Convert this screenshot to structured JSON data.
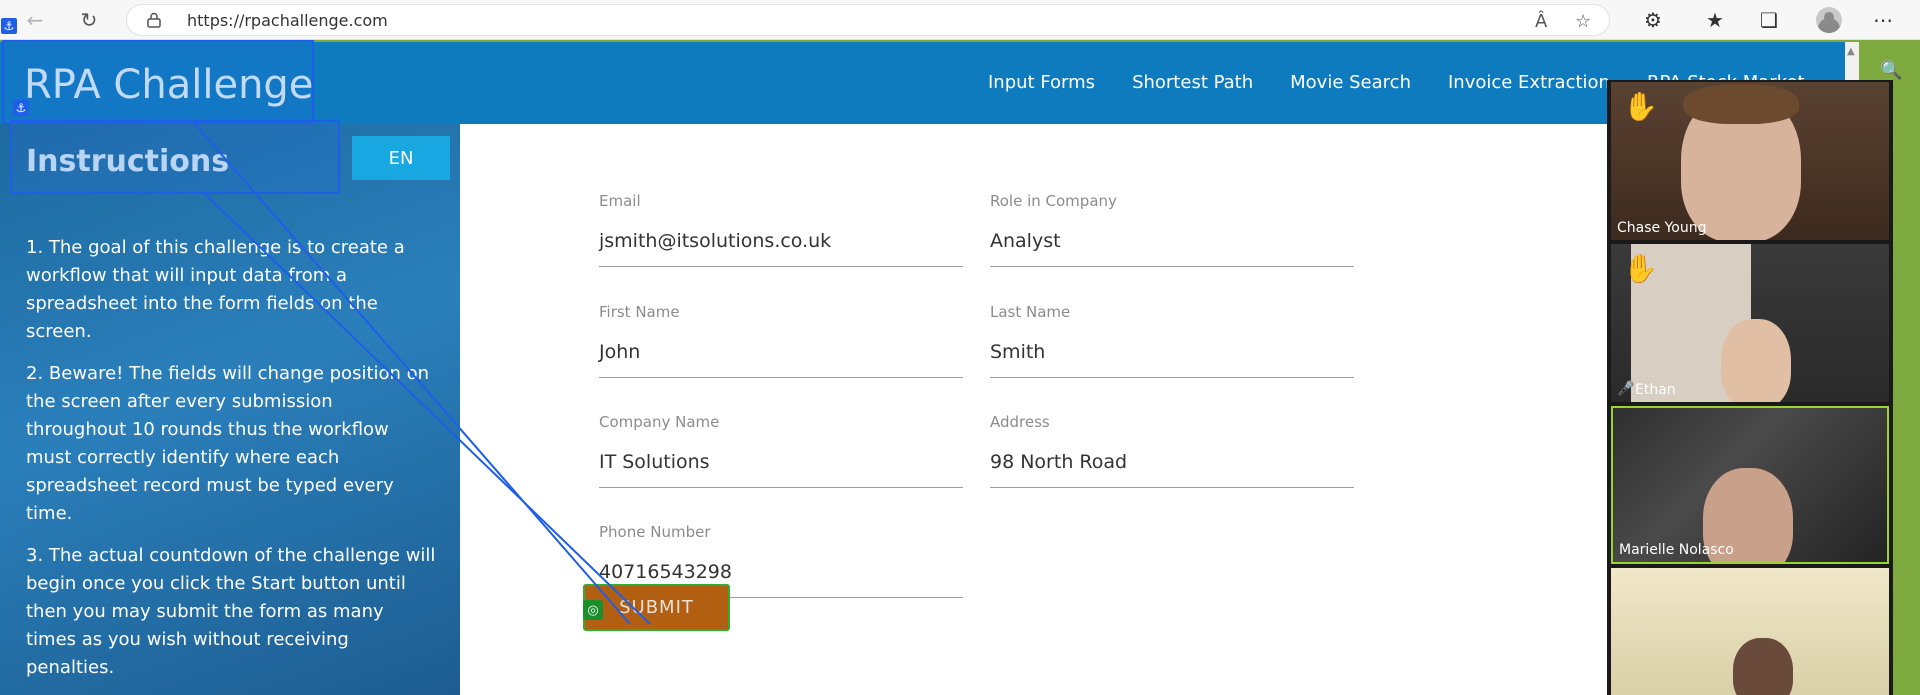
{
  "browser": {
    "url": "https://rpachallenge.com"
  },
  "site": {
    "brand": "RPA Challenge",
    "nav": [
      "Input Forms",
      "Shortest Path",
      "Movie Search",
      "Invoice Extraction",
      "RPA Stock Market"
    ]
  },
  "sidebar": {
    "title": "Instructions",
    "lang_button": "EN",
    "paragraphs": [
      "1. The goal of this challenge is to create a workflow that will input data from a spreadsheet into the form fields on the screen.",
      "2. Beware! The fields will change position on the screen after every submission throughout 10 rounds thus the workflow must correctly identify where each spreadsheet record must be typed every time.",
      "3. The actual countdown of the challenge will begin once you click the Start button until then you may submit the form as many times as you wish without receiving penalties."
    ]
  },
  "form": {
    "email": {
      "label": "Email",
      "value": "jsmith@itsolutions.co.uk"
    },
    "role": {
      "label": "Role in Company",
      "value": "Analyst"
    },
    "first_name": {
      "label": "First Name",
      "value": "John"
    },
    "last_name": {
      "label": "Last Name",
      "value": "Smith"
    },
    "company": {
      "label": "Company Name",
      "value": "IT Solutions"
    },
    "address": {
      "label": "Address",
      "value": "98 North Road"
    },
    "phone": {
      "label": "Phone Number",
      "value": "40716543298"
    },
    "submit_label": "SUBMIT"
  },
  "meeting": {
    "participants": [
      {
        "name": "Chase Young",
        "hand_raised": true
      },
      {
        "name": "Ethan",
        "hand_raised": true,
        "muted": true
      },
      {
        "name": "Marielle Nolasco",
        "active_speaker": true
      },
      {
        "name": ""
      }
    ]
  },
  "colors": {
    "header": "#0e7bbf",
    "submit": "#b35f12",
    "overlay": "#1e5ee8"
  }
}
